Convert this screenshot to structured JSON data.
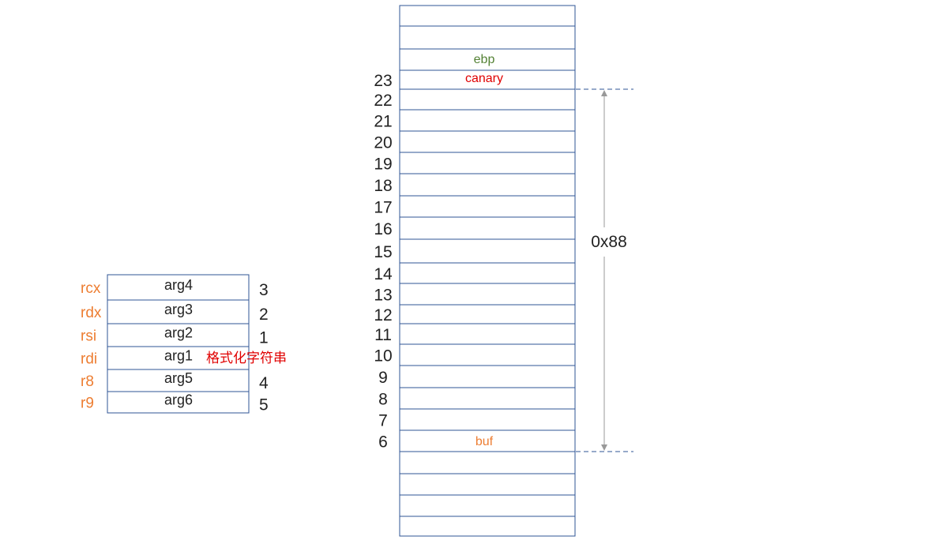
{
  "colors": {
    "border": "#2f5496",
    "register": "#ed7d31",
    "ebp": "#548235",
    "canary": "#e00000",
    "buf": "#ed7d31",
    "format": "#e00000",
    "dim_line": "#999999",
    "dashed": "#2f5496"
  },
  "left_table": {
    "rows": [
      {
        "register": "rcx",
        "arg": "arg4",
        "index": "3"
      },
      {
        "register": "rdx",
        "arg": "arg3",
        "index": "2"
      },
      {
        "register": "rsi",
        "arg": "arg2",
        "index": "1"
      },
      {
        "register": "rdi",
        "arg": "arg1",
        "index": ""
      },
      {
        "register": "r8",
        "arg": "arg5",
        "index": "4"
      },
      {
        "register": "r9",
        "arg": "arg6",
        "index": "5"
      }
    ],
    "format_string_label": "格式化字符串"
  },
  "stack": {
    "row_count": 25,
    "row_numbers": [
      "23",
      "22",
      "21",
      "20",
      "19",
      "18",
      "17",
      "16",
      "15",
      "14",
      "13",
      "12",
      "11",
      "10",
      "9",
      "8",
      "7",
      "6"
    ],
    "labels": {
      "ebp": "ebp",
      "canary": "canary",
      "buf": "buf"
    }
  },
  "dimension": {
    "label": "0x88"
  }
}
